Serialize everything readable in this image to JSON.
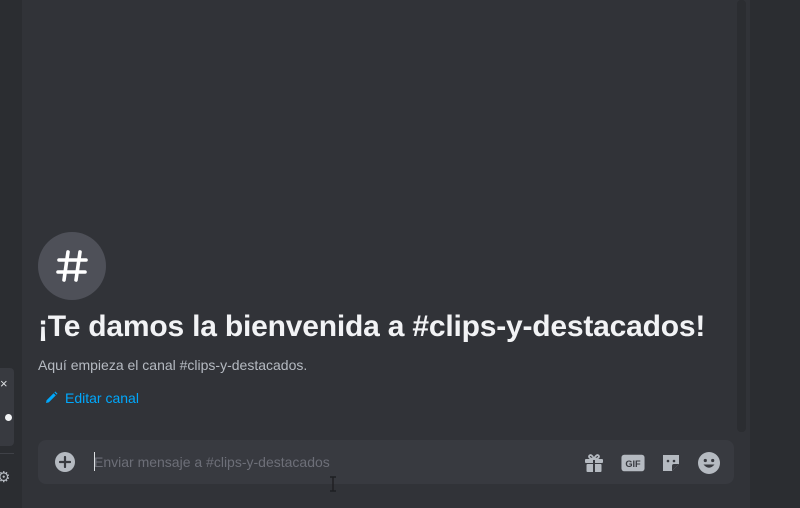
{
  "left_panel": {
    "close_glyph": "×",
    "gear_glyph": "⚙"
  },
  "channel": {
    "hash_glyph": "#",
    "welcome_title": "¡Te damos la bienvenida a #clips-y-destacados!",
    "welcome_subtitle": "Aquí empieza el canal #clips-y-destacados.",
    "edit_label": "Editar canal"
  },
  "composer": {
    "placeholder": "Enviar mensaje a #clips-y-destacados",
    "value": "",
    "tools": [
      {
        "icon": "gift-icon"
      },
      {
        "icon": "gif-icon",
        "label": "GIF"
      },
      {
        "icon": "sticker-icon"
      },
      {
        "icon": "emoji-icon"
      }
    ]
  },
  "colors": {
    "background": "#313338",
    "sidebar": "#2b2d31",
    "composer": "#383a40",
    "link": "#00a8fc",
    "title": "#f2f3f5",
    "muted": "#b5bac1"
  }
}
